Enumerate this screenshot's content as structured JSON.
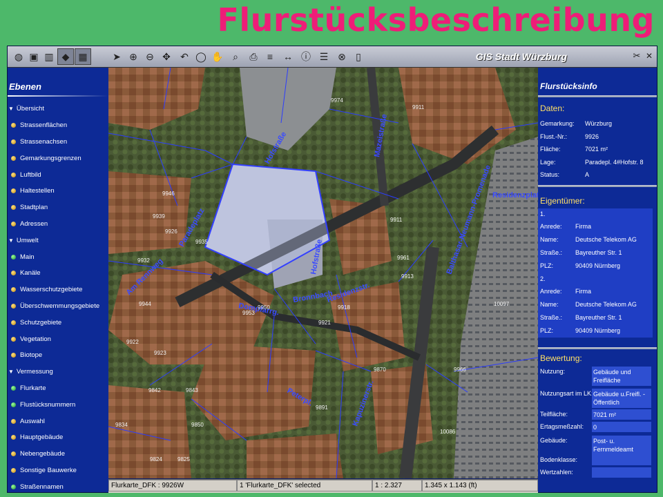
{
  "slide_title": "Flurstücksbeschreibung",
  "app": {
    "title": "GIS Stadt Würzburg",
    "colors": {
      "accent": "#ee1d78",
      "panel": "#0d2a96",
      "section": "#ffe066"
    }
  },
  "toolbar": {
    "icons": [
      "globe-icon",
      "bookmark-icon",
      "chart-icon",
      "layer-icon",
      "image-icon",
      "pointer-icon",
      "zoom-in-icon",
      "zoom-out-icon",
      "pan-arrow-icon",
      "zoom-prev-icon",
      "zoom-extent-icon",
      "hand-icon",
      "identify-icon",
      "print-icon",
      "legend-icon",
      "measure-icon",
      "globe-info-icon",
      "list-icon",
      "close-circle-icon",
      "panel-icon"
    ]
  },
  "sidebar": {
    "heading": "Ebenen",
    "items": [
      {
        "label": "Übersicht",
        "type": "group"
      },
      {
        "label": "Strassenflächen",
        "type": "layer",
        "color": "orange"
      },
      {
        "label": "Strassenachsen",
        "type": "layer",
        "color": "orange"
      },
      {
        "label": "Gemarkungsgrenzen",
        "type": "layer",
        "color": "orange"
      },
      {
        "label": "Luftbild",
        "type": "layer",
        "color": "orange"
      },
      {
        "label": "Haltestellen",
        "type": "layer",
        "color": "orange"
      },
      {
        "label": "Stadtplan",
        "type": "layer",
        "color": "orange"
      },
      {
        "label": "Adressen",
        "type": "layer",
        "color": "orange"
      },
      {
        "label": "Umwelt",
        "type": "group"
      },
      {
        "label": "Main",
        "type": "layer",
        "color": "green"
      },
      {
        "label": "Kanäle",
        "type": "layer",
        "color": "orange"
      },
      {
        "label": "Wasserschutzgebiete",
        "type": "layer",
        "color": "orange"
      },
      {
        "label": "Überschwemmungsgebiete",
        "type": "layer",
        "color": "orange"
      },
      {
        "label": "Schutzgebiete",
        "type": "layer",
        "color": "orange"
      },
      {
        "label": "Vegetation",
        "type": "layer",
        "color": "orange"
      },
      {
        "label": "Biotope",
        "type": "layer",
        "color": "orange"
      },
      {
        "label": "Vermessung",
        "type": "group"
      },
      {
        "label": "Flurkarte",
        "type": "layer",
        "color": "green"
      },
      {
        "label": "Flustücksnummern",
        "type": "layer",
        "color": "green"
      },
      {
        "label": "Auswahl",
        "type": "layer",
        "color": "orange"
      },
      {
        "label": "Hauptgebäude",
        "type": "layer",
        "color": "orange"
      },
      {
        "label": "Nebengebäude",
        "type": "layer",
        "color": "orange"
      },
      {
        "label": "Sonstige Bauwerke",
        "type": "layer",
        "color": "orange"
      },
      {
        "label": "Straßennamen",
        "type": "layer",
        "color": "green"
      }
    ]
  },
  "map": {
    "street_labels": [
      "Residenzplatz",
      "Mazeistraße",
      "Am Rennweg",
      "Balthasar-Neumann-Promenade",
      "Hofstraße",
      "Paradeplatz",
      "Dompfarrg.",
      "Bronnbach",
      "Hofstraße",
      "Residenzstr.",
      "Peterpl.",
      "Kapuzinerstr."
    ],
    "parcel_numbers": [
      "9926",
      "9946",
      "9961",
      "9935",
      "9939",
      "9932",
      "9944",
      "9911",
      "9913",
      "9918",
      "9921",
      "9922",
      "9923",
      "9842",
      "9843",
      "9850",
      "9891",
      "9834",
      "9870",
      "9966",
      "10086",
      "10097",
      "9974",
      "9911",
      "9950",
      "9953",
      "9824",
      "9825"
    ]
  },
  "statusbar": {
    "layer": "Flurkarte_DFK : 9926W",
    "selection": "1 'Flurkarte_DFK' selected",
    "scale": "1 : 2.327",
    "size": "1.345 x 1.143 (ft)"
  },
  "info": {
    "heading": "Flurstücksinfo",
    "daten": {
      "title": "Daten:",
      "rows": [
        {
          "label": "Gemarkung:",
          "value": "Würzburg"
        },
        {
          "label": "Flust.-Nr.:",
          "value": "9926"
        },
        {
          "label": "Fläche:",
          "value": "7021 m²"
        },
        {
          "label": "Lage:",
          "value": "Paradepl. 4#Hofstr. 8"
        },
        {
          "label": "Status:",
          "value": "A"
        }
      ]
    },
    "eigentuemer": {
      "title": "Eigentümer:",
      "owners": [
        {
          "num": "1.",
          "anrede": "Firma",
          "name": "Deutsche Telekom AG",
          "strasse": "Bayreuther Str. 1",
          "plz": "90409 Nürnberg"
        },
        {
          "num": "2.",
          "anrede": "Firma",
          "name": "Deutsche Telekom AG",
          "strasse": "Bayreuther Str. 1",
          "plz": "90409 Nürnberg"
        }
      ],
      "labels": {
        "anrede": "Anrede:",
        "name": "Name:",
        "strasse": "Straße.:",
        "plz": "PLZ:"
      }
    },
    "bewertung": {
      "title": "Bewertung:",
      "rows": [
        {
          "label": "Nutzung:",
          "value": "Gebäude und Freifläche"
        },
        {
          "label": "Nutzungsart im LK:",
          "value": "Gebäude u.Freifl. - Öffentlich"
        },
        {
          "label": "Teilfläche:",
          "value": "7021 m²"
        },
        {
          "label": "Ertagsmeßzahl:",
          "value": "0"
        },
        {
          "label": "Gebäude:",
          "value": "Post- u. Fernmeldeamt"
        },
        {
          "label": "Bodenklasse:",
          "value": ""
        },
        {
          "label": "Wertzahlen:",
          "value": ""
        }
      ]
    }
  }
}
